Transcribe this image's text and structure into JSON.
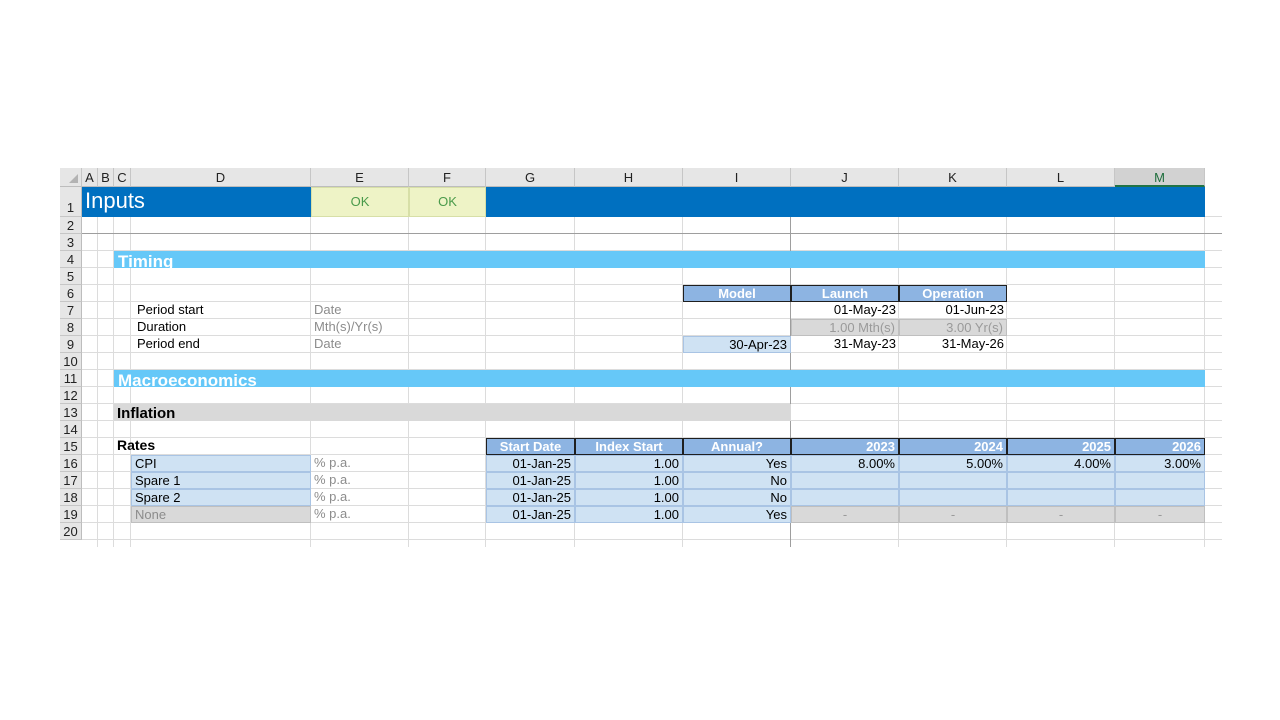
{
  "columns": [
    "A",
    "B",
    "C",
    "D",
    "E",
    "F",
    "G",
    "H",
    "I",
    "J",
    "K",
    "L",
    "M"
  ],
  "rows": [
    "1",
    "2",
    "3",
    "4",
    "5",
    "6",
    "7",
    "8",
    "9",
    "10",
    "11",
    "12",
    "13",
    "14",
    "15",
    "16",
    "17",
    "18",
    "19",
    "20"
  ],
  "title": "Inputs",
  "checks": {
    "e1": "OK",
    "f1": "OK"
  },
  "sections": {
    "timing": "Timing",
    "macro": "Macroeconomics",
    "inflation": "Inflation",
    "rates": "Rates"
  },
  "timing": {
    "headers": {
      "model": "Model",
      "launch": "Launch",
      "operation": "Operation"
    },
    "rows": [
      {
        "label": "Period start",
        "unit": "Date",
        "model": "",
        "launch": "01-May-23",
        "operation": "01-Jun-23"
      },
      {
        "label": "Duration",
        "unit": "Mth(s)/Yr(s)",
        "model": "",
        "launch": "1.00 Mth(s)",
        "operation": "3.00 Yr(s)"
      },
      {
        "label": "Period end",
        "unit": "Date",
        "model": "30-Apr-23",
        "launch": "31-May-23",
        "operation": "31-May-26"
      }
    ]
  },
  "rates_table": {
    "headers": {
      "start_date": "Start Date",
      "index_start": "Index Start",
      "annual": "Annual?",
      "y2023": "2023",
      "y2024": "2024",
      "y2025": "2025",
      "y2026": "2026"
    },
    "rows": [
      {
        "label": "CPI",
        "unit": "% p.a.",
        "start_date": "01-Jan-25",
        "index_start": "1.00",
        "annual": "Yes",
        "y2023": "8.00%",
        "y2024": "5.00%",
        "y2025": "4.00%",
        "y2026": "3.00%"
      },
      {
        "label": "Spare 1",
        "unit": "% p.a.",
        "start_date": "01-Jan-25",
        "index_start": "1.00",
        "annual": "No",
        "y2023": "",
        "y2024": "",
        "y2025": "",
        "y2026": ""
      },
      {
        "label": "Spare 2",
        "unit": "% p.a.",
        "start_date": "01-Jan-25",
        "index_start": "1.00",
        "annual": "No",
        "y2023": "",
        "y2024": "",
        "y2025": "",
        "y2026": ""
      },
      {
        "label": "None",
        "unit": "% p.a.",
        "start_date": "01-Jan-25",
        "index_start": "1.00",
        "annual": "Yes",
        "y2023": "-",
        "y2024": "-",
        "y2025": "-",
        "y2026": "-"
      }
    ]
  },
  "colors": {
    "banner": "#0070c0",
    "section": "#66c8f8",
    "header": "#8db4e2",
    "input": "#cfe2f3",
    "ok": "#eef3c6"
  }
}
